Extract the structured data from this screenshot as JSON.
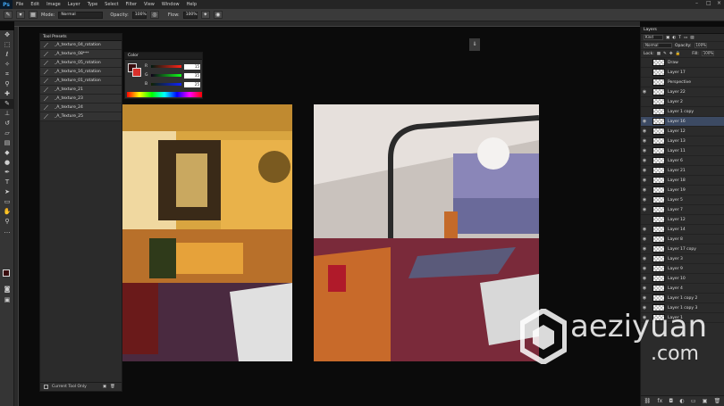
{
  "app": {
    "logo": "Ps"
  },
  "menubar": [
    "File",
    "Edit",
    "Image",
    "Layer",
    "Type",
    "Select",
    "Filter",
    "View",
    "Window",
    "Help"
  ],
  "options": {
    "mode_label": "Mode:",
    "mode_value": "Normal",
    "opacity_label": "Opacity:",
    "opacity_value": "100%",
    "flow_label": "Flow:",
    "flow_value": "100%"
  },
  "tool_presets": {
    "title": "Tool Presets",
    "items": [
      "_A_texture_04_rotation",
      "_A_texture_08***",
      "_A_texture_05_rotation",
      "_A_texture_16_rotation",
      "_A_texture_01_rotation",
      "_A_texture_21",
      "_A_texture_23",
      "_A_texture_24",
      "_A_Texture_25"
    ],
    "current_tool_only": "Current Tool Only"
  },
  "color_panel": {
    "title": "Color",
    "rows": [
      {
        "label": "R",
        "value": "15"
      },
      {
        "label": "G",
        "value": "35"
      },
      {
        "label": "B",
        "value": "25"
      }
    ]
  },
  "layers_panel": {
    "title": "Layers",
    "kind_label": "Kind",
    "blend_mode": "Normal",
    "opacity_label": "Opacity:",
    "opacity_value": "100%",
    "lock_label": "Lock:",
    "fill_label": "Fill:",
    "fill_value": "100%",
    "layers": [
      {
        "name": "Draw",
        "visible": false,
        "selected": false,
        "swatch": "#8b1a1a"
      },
      {
        "name": "Layer 17",
        "visible": false,
        "selected": false,
        "swatch": "#8b1a1a"
      },
      {
        "name": "Perspective",
        "visible": false,
        "selected": false,
        "swatch": "#b59a1a"
      },
      {
        "name": "Layer 22",
        "visible": true,
        "selected": false,
        "swatch": ""
      },
      {
        "name": "Layer 2",
        "visible": false,
        "selected": false,
        "swatch": ""
      },
      {
        "name": "Layer 1 copy",
        "visible": false,
        "selected": false,
        "swatch": ""
      },
      {
        "name": "Layer 16",
        "visible": true,
        "selected": true,
        "swatch": ""
      },
      {
        "name": "Layer 12",
        "visible": true,
        "selected": false,
        "swatch": ""
      },
      {
        "name": "Layer 13",
        "visible": true,
        "selected": false,
        "swatch": ""
      },
      {
        "name": "Layer 11",
        "visible": true,
        "selected": false,
        "swatch": ""
      },
      {
        "name": "Layer 6",
        "visible": true,
        "selected": false,
        "swatch": ""
      },
      {
        "name": "Layer 21",
        "visible": true,
        "selected": false,
        "swatch": ""
      },
      {
        "name": "Layer 18",
        "visible": true,
        "selected": false,
        "swatch": ""
      },
      {
        "name": "Layer 19",
        "visible": true,
        "selected": false,
        "swatch": ""
      },
      {
        "name": "Layer 5",
        "visible": true,
        "selected": false,
        "swatch": ""
      },
      {
        "name": "Layer 7",
        "visible": true,
        "selected": false,
        "swatch": ""
      },
      {
        "name": "Layer 12",
        "visible": false,
        "selected": false,
        "swatch": ""
      },
      {
        "name": "Layer 14",
        "visible": true,
        "selected": false,
        "swatch": ""
      },
      {
        "name": "Layer 8",
        "visible": true,
        "selected": false,
        "swatch": ""
      },
      {
        "name": "Layer 17 copy",
        "visible": true,
        "selected": false,
        "swatch": ""
      },
      {
        "name": "Layer 3",
        "visible": true,
        "selected": false,
        "swatch": ""
      },
      {
        "name": "Layer 9",
        "visible": true,
        "selected": false,
        "swatch": ""
      },
      {
        "name": "Layer 10",
        "visible": true,
        "selected": false,
        "swatch": ""
      },
      {
        "name": "Layer 4",
        "visible": true,
        "selected": false,
        "swatch": ""
      },
      {
        "name": "Layer 1 copy 2",
        "visible": true,
        "selected": false,
        "swatch": ""
      },
      {
        "name": "Layer 1 copy 3",
        "visible": true,
        "selected": false,
        "swatch": ""
      },
      {
        "name": "Layer 1",
        "visible": true,
        "selected": false,
        "swatch": ""
      }
    ]
  },
  "watermark": {
    "line1": "aeziyuan",
    "line2": ".com"
  },
  "colors": {
    "foreground": "#3a0d0e",
    "background": "#d8302b",
    "selection": "#3c4a63"
  }
}
